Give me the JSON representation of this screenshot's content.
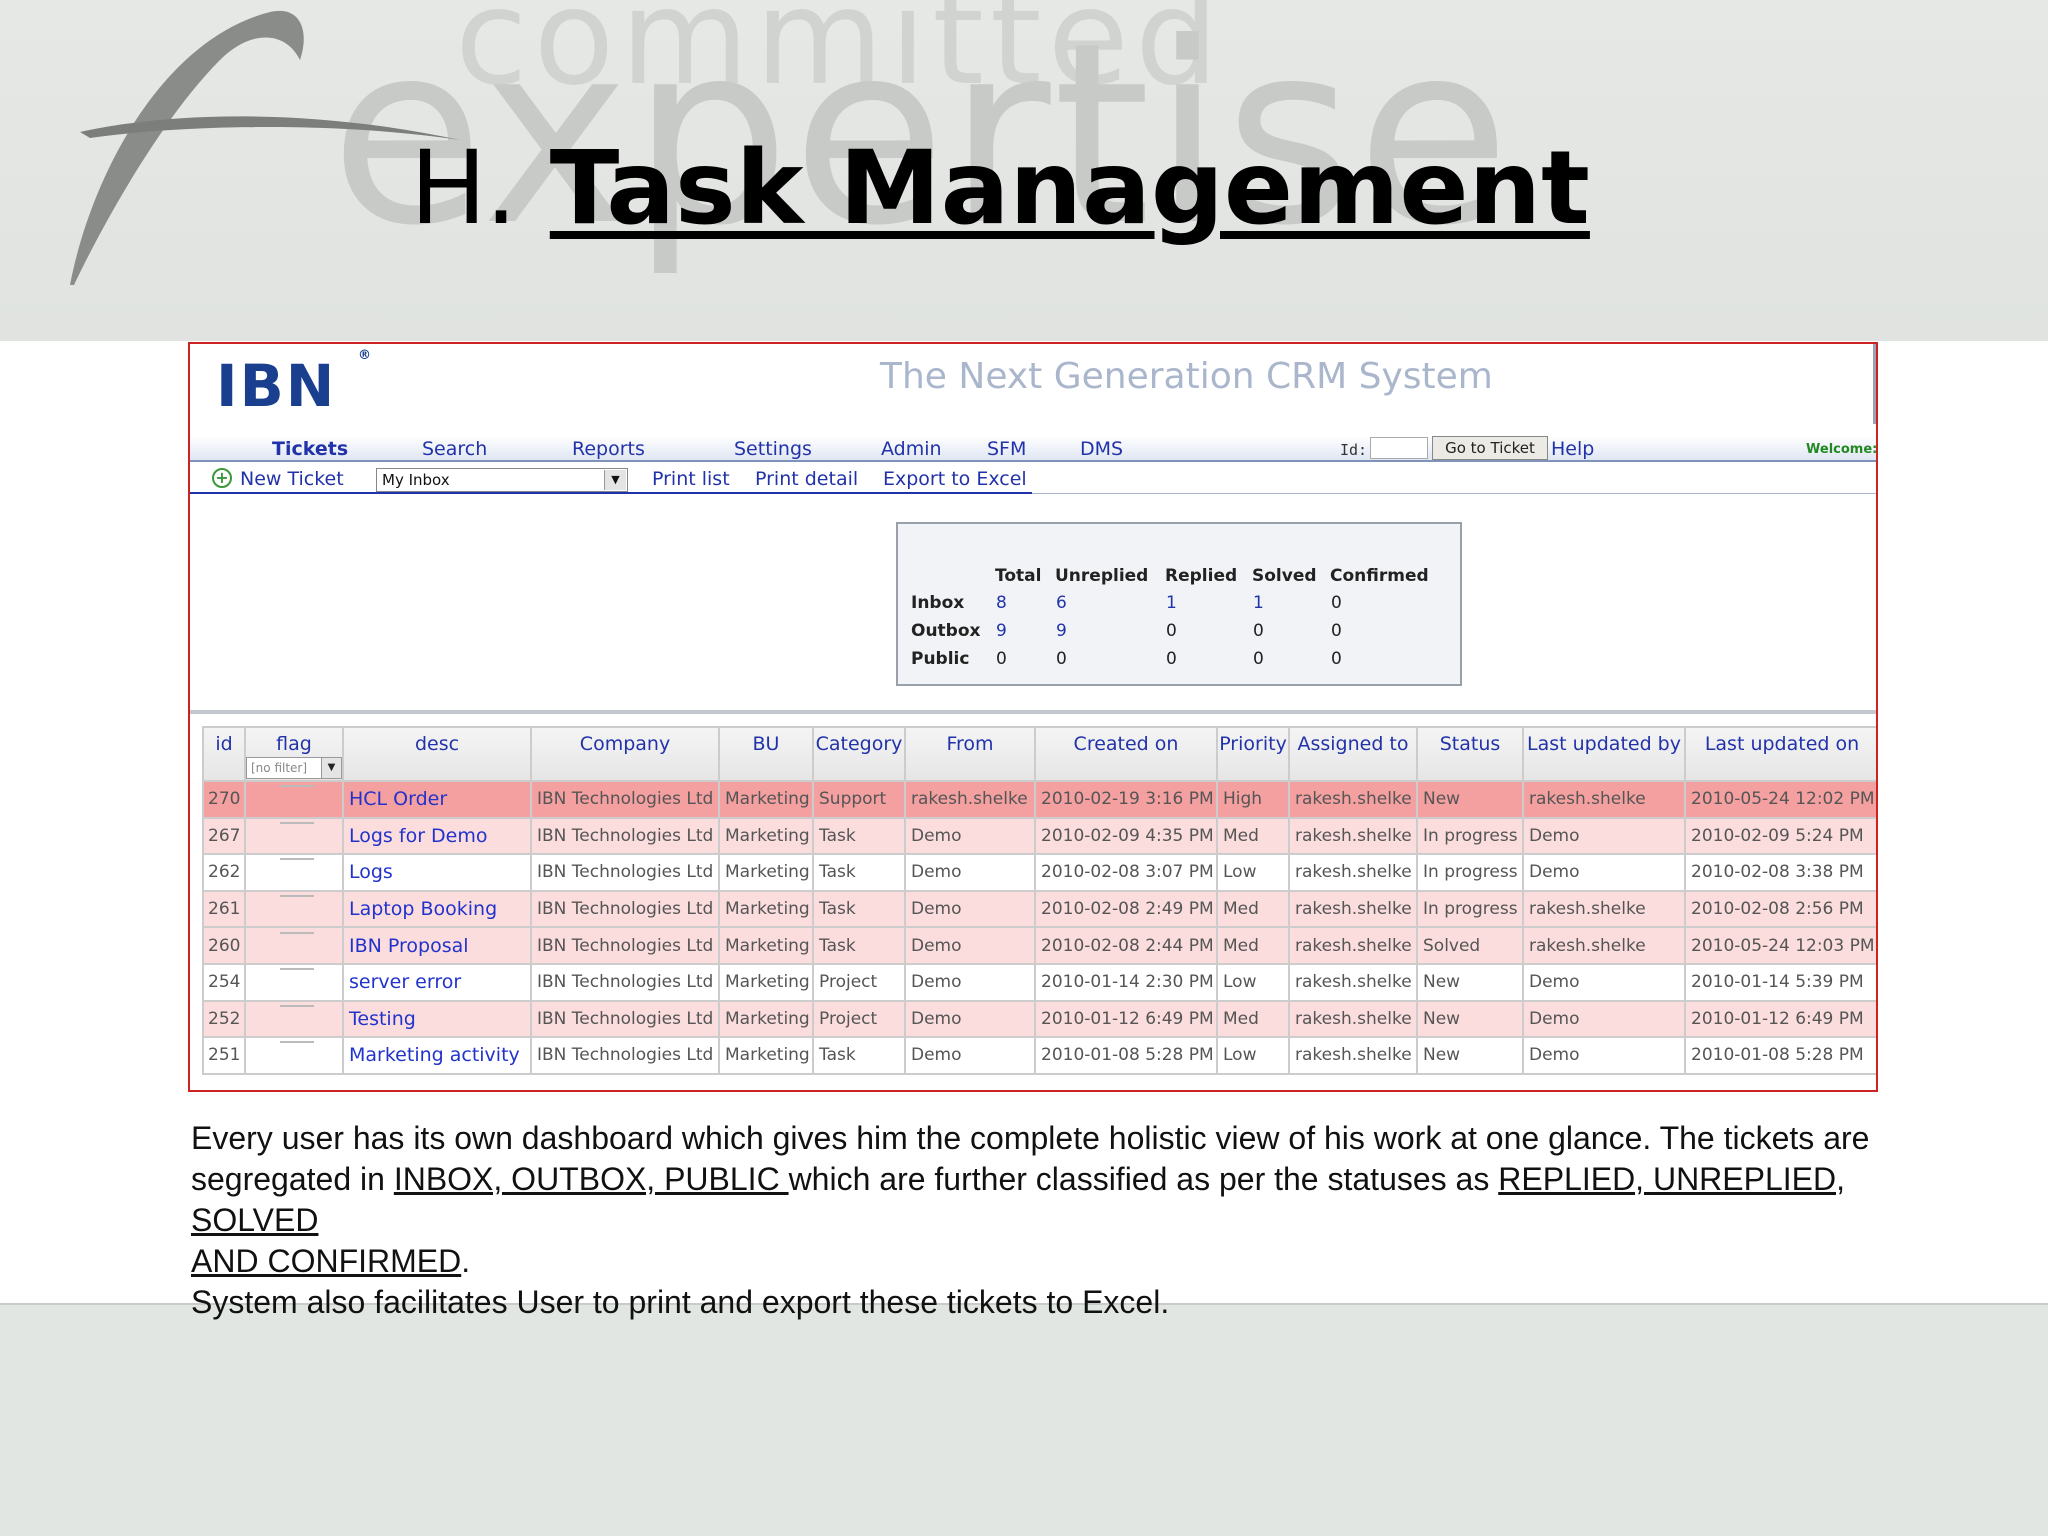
{
  "slide": {
    "watermark_top": "committed",
    "watermark_bottom": "expertise",
    "title_prefix": "H.",
    "title_main": "Task Management"
  },
  "crm": {
    "logo": "IBN",
    "logo_mark": "®",
    "tagline": "The Next Generation CRM System",
    "nav": {
      "tickets": "Tickets",
      "search": "Search",
      "reports": "Reports",
      "settings": "Settings",
      "admin": "Admin",
      "sfm": "SFM",
      "dms": "DMS",
      "id_label": "Id:",
      "goto": "Go to Ticket",
      "help": "Help",
      "welcome": "Welcome:"
    },
    "toolbar": {
      "plus": "+",
      "new_ticket": "New Ticket",
      "view_select": "My Inbox",
      "print_list": "Print list",
      "print_detail": "Print detail",
      "export": "Export to Excel"
    },
    "stats": {
      "headers": [
        "Total",
        "Unreplied",
        "Replied",
        "Solved",
        "Confirmed"
      ],
      "rows": [
        {
          "label": "Inbox",
          "values": [
            "8",
            "6",
            "1",
            "1",
            "0"
          ]
        },
        {
          "label": "Outbox",
          "values": [
            "9",
            "9",
            "0",
            "0",
            "0"
          ]
        },
        {
          "label": "Public",
          "values": [
            "0",
            "0",
            "0",
            "0",
            "0"
          ]
        }
      ]
    },
    "table": {
      "columns": [
        "id",
        "flag",
        "desc",
        "Company",
        "BU",
        "Category",
        "From",
        "Created on",
        "Priority",
        "Assigned to",
        "Status",
        "Last updated by",
        "Last updated on"
      ],
      "flag_filter": "[no filter]",
      "rows": [
        {
          "id": "270",
          "desc": "HCL Order",
          "company": "IBN Technologies Ltd",
          "bu": "Marketing",
          "category": "Support",
          "from": "rakesh.shelke",
          "created": "2010-02-19 3:16 PM",
          "priority": "High",
          "assigned": "rakesh.shelke",
          "status": "New",
          "updated_by": "rakesh.shelke",
          "updated_on": "2010-05-24 12:02 PM"
        },
        {
          "id": "267",
          "desc": "Logs for Demo",
          "company": "IBN Technologies Ltd",
          "bu": "Marketing",
          "category": "Task",
          "from": "Demo",
          "created": "2010-02-09 4:35 PM",
          "priority": "Med",
          "assigned": "rakesh.shelke",
          "status": "In progress",
          "updated_by": "Demo",
          "updated_on": "2010-02-09 5:24 PM"
        },
        {
          "id": "262",
          "desc": "Logs",
          "company": "IBN Technologies Ltd",
          "bu": "Marketing",
          "category": "Task",
          "from": "Demo",
          "created": "2010-02-08 3:07 PM",
          "priority": "Low",
          "assigned": "rakesh.shelke",
          "status": "In progress",
          "updated_by": "Demo",
          "updated_on": "2010-02-08 3:38 PM"
        },
        {
          "id": "261",
          "desc": "Laptop Booking",
          "company": "IBN Technologies Ltd",
          "bu": "Marketing",
          "category": "Task",
          "from": "Demo",
          "created": "2010-02-08 2:49 PM",
          "priority": "Med",
          "assigned": "rakesh.shelke",
          "status": "In progress",
          "updated_by": "rakesh.shelke",
          "updated_on": "2010-02-08 2:56 PM"
        },
        {
          "id": "260",
          "desc": "IBN Proposal",
          "company": "IBN Technologies Ltd",
          "bu": "Marketing",
          "category": "Task",
          "from": "Demo",
          "created": "2010-02-08 2:44 PM",
          "priority": "Med",
          "assigned": "rakesh.shelke",
          "status": "Solved",
          "updated_by": "rakesh.shelke",
          "updated_on": "2010-05-24 12:03 PM"
        },
        {
          "id": "254",
          "desc": "server error",
          "company": "IBN Technologies Ltd",
          "bu": "Marketing",
          "category": "Project",
          "from": "Demo",
          "created": "2010-01-14 2:30 PM",
          "priority": "Low",
          "assigned": "rakesh.shelke",
          "status": "New",
          "updated_by": "Demo",
          "updated_on": "2010-01-14 5:39 PM"
        },
        {
          "id": "252",
          "desc": "Testing",
          "company": "IBN Technologies Ltd",
          "bu": "Marketing",
          "category": "Project",
          "from": "Demo",
          "created": "2010-01-12 6:49 PM",
          "priority": "Med",
          "assigned": "rakesh.shelke",
          "status": "New",
          "updated_by": "Demo",
          "updated_on": "2010-01-12 6:49 PM"
        },
        {
          "id": "251",
          "desc": "Marketing activity",
          "company": "IBN Technologies Ltd",
          "bu": "Marketing",
          "category": "Task",
          "from": "Demo",
          "created": "2010-01-08 5:28 PM",
          "priority": "Low",
          "assigned": "rakesh.shelke",
          "status": "New",
          "updated_by": "Demo",
          "updated_on": "2010-01-08 5:28 PM"
        }
      ]
    }
  },
  "caption": {
    "line1": "Every user has its own dashboard which gives him the complete holistic view of his work at one glance. The tickets are",
    "line2_pre": "segregated in ",
    "line2_u1": "INBOX, OUTBOX, PUBLIC ",
    "line2_mid": "which are further classified as per the statuses as ",
    "line2_u2": "REPLIED, UNREPLIED, SOLVED",
    "line3_u": "AND CONFIRMED",
    "line3_post": ".",
    "line4": "System also facilitates User to print and export these tickets to Excel."
  },
  "colors": {
    "link": "#2233aa",
    "row_highlight": "#f4a0a0",
    "row_pink": "#fbdddd",
    "frame": "#cc2222"
  }
}
